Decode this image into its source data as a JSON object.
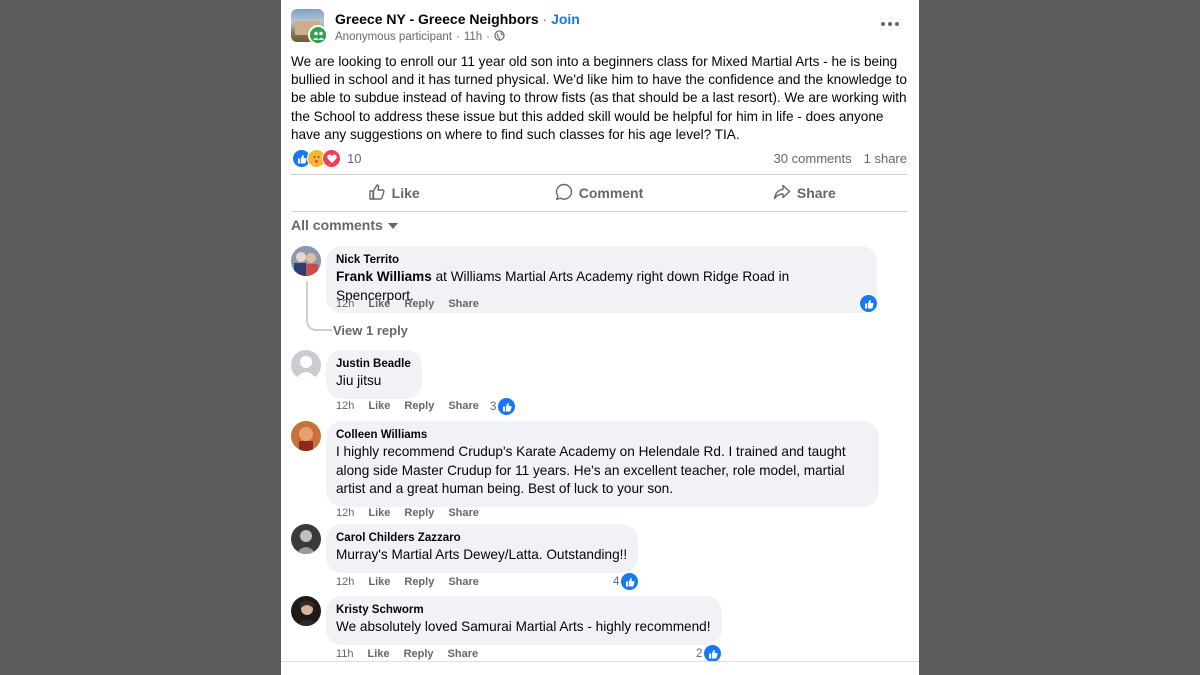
{
  "post": {
    "group_name": "Greece NY - Greece Neighbors",
    "separator": "·",
    "join_label": "Join",
    "author": "Anonymous participant",
    "time": "11h",
    "text": "We are looking to enroll our 11 year old son into a beginners class for Mixed Martial Arts - he is being bullied in school and it has turned physical. We'd like him to have the confidence and the knowledge to be able to subdue instead of having to throw fists (as that should be a last resort). We are working with the School to address these issue but this added skill would be helpful for him in life - does anyone have any suggestions on where to find such classes for his age level? TIA.",
    "reaction_count": "10",
    "comments_count": "30 comments",
    "shares_count": "1 share"
  },
  "actions": {
    "like": "Like",
    "comment": "Comment",
    "share": "Share"
  },
  "comments_filter": "All comments",
  "comments": [
    {
      "author": "Nick Territo",
      "mention": "Frank Williams",
      "text": " at Williams Martial Arts Academy right down Ridge Road in Spencerport.",
      "time": "12h",
      "like": "Like",
      "reply": "Reply",
      "share": "Share",
      "reactions": ""
    },
    {
      "author": "Justin Beadle",
      "text": "Jiu jitsu",
      "time": "12h",
      "like": "Like",
      "reply": "Reply",
      "share": "Share",
      "reactions": "3"
    },
    {
      "author": "Colleen Williams",
      "text": "I highly recommend Crudup's Karate Academy on Helendale Rd. I trained and taught along side Master Crudup for 11 years. He's an excellent teacher, role model, martial artist and a great human being. Best of luck to your son.",
      "time": "12h",
      "like": "Like",
      "reply": "Reply",
      "share": "Share",
      "reactions": ""
    },
    {
      "author": "Carol Childers Zazzaro",
      "text": "Murray's Martial Arts Dewey/Latta. Outstanding!!",
      "time": "12h",
      "like": "Like",
      "reply": "Reply",
      "share": "Share",
      "reactions": "4"
    },
    {
      "author": "Kristy Schworm",
      "text": "We absolutely loved Samurai Martial Arts - highly recommend!",
      "time": "11h",
      "like": "Like",
      "reply": "Reply",
      "share": "Share",
      "reactions": "2"
    }
  ],
  "view_replies": "View 1 reply",
  "colors": {
    "accent": "#1877f2",
    "bubble": "#f0f2f5",
    "muted": "#65676b",
    "backdrop": "#5a5b5d"
  }
}
